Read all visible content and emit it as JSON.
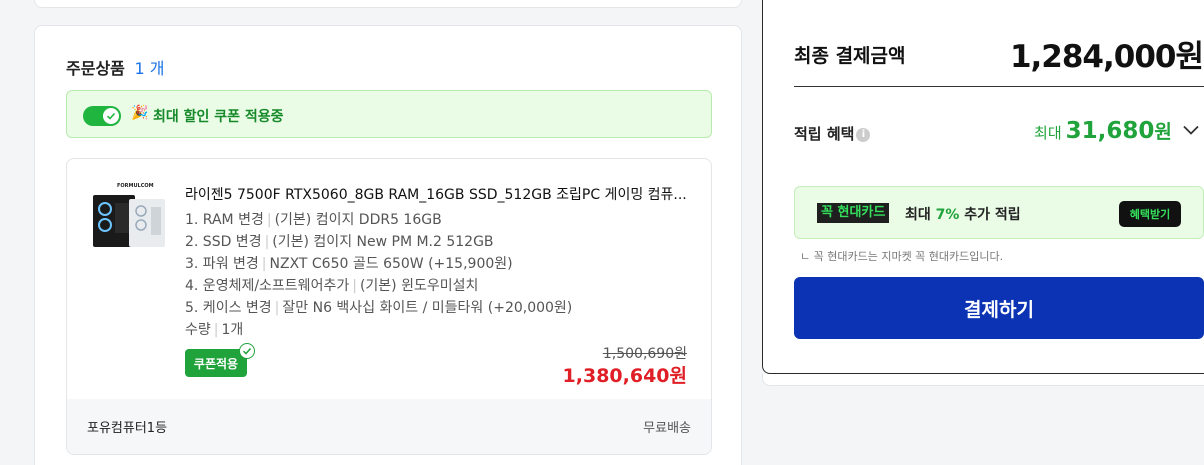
{
  "order": {
    "title": "주문상품",
    "count": "1 개",
    "coupon_banner": "최대 할인 쿠폰 적용중",
    "product": {
      "name": "라이젠5 7500F RTX5060_8GB RAM_16GB SSD_512GB 조립PC 게이밍 컴퓨...",
      "brand_on_image": "FORMULCOM",
      "options": [
        {
          "label": "1. RAM 변경",
          "value": "(기본) 컴이지 DDR5 16GB"
        },
        {
          "label": "2. SSD 변경",
          "value": "(기본) 컴이지 New PM M.2 512GB"
        },
        {
          "label": "3. 파워 변경",
          "value": "NZXT C650 골드 650W (+15,900원)"
        },
        {
          "label": "4. 운영체제/소프트웨어추가",
          "value": "(기본) 윈도우미설치"
        },
        {
          "label": "5. 케이스 변경",
          "value": "잘만 N6 백사십 화이트 / 미들타워 (+20,000원)"
        },
        {
          "label": "수량",
          "value": "1개"
        }
      ],
      "coupon_badge": "쿠폰적용",
      "original_price": "1,500,690원",
      "sale_price": "1,380,640원"
    },
    "seller": "포유컴퓨터1등",
    "shipping": "무료배송"
  },
  "payment": {
    "final_label": "최종 결제금액",
    "final_amount": "1,284,000원",
    "reward_label": "적립 혜택",
    "reward_prefix": "최대",
    "reward_amount": "31,680",
    "reward_unit": "원",
    "card_brand": "꼭 현대카드",
    "promo_prefix": "최대",
    "promo_pct": "7%",
    "promo_suffix": "추가 적립",
    "benefit_button": "혜택받기",
    "promo_note": "ㄴ 꼭 현대카드는 지마켓 꼭 현대카드입니다.",
    "pay_button": "결제하기"
  },
  "colors": {
    "accent_blue": "#0b33b3",
    "green": "#1fa33a",
    "red_price": "#e01e26"
  }
}
